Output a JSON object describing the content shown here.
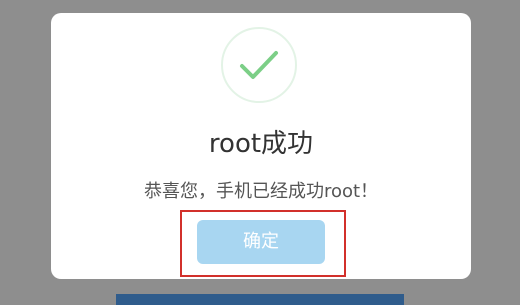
{
  "dialog": {
    "title": "root成功",
    "message": "恭喜您，手机已经成功root！",
    "confirm_label": "确定",
    "icon": "checkmark-icon"
  },
  "colors": {
    "backdrop": "#8e8e8e",
    "dialog_bg": "#ffffff",
    "check": "#7ccf87",
    "icon_ring": "#e3f3e6",
    "button_bg": "#a8d6f1",
    "highlight": "#d2302b",
    "bottom_bar": "#2f5c8c"
  }
}
